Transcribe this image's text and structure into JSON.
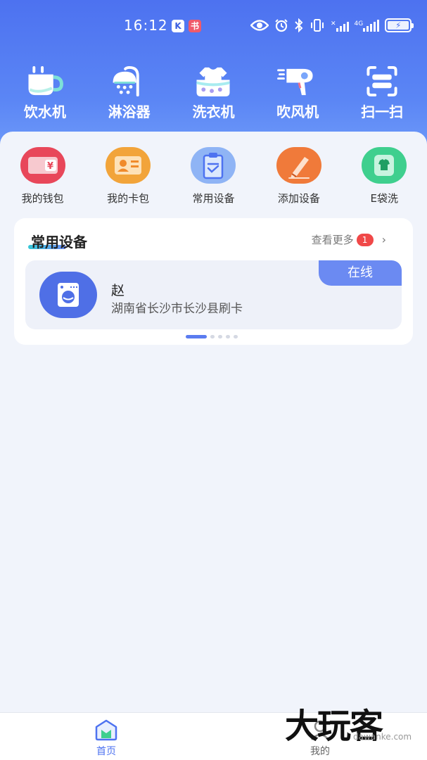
{
  "status_bar": {
    "time": "16:12",
    "app_icon_1": "K",
    "app_icon_2": "书",
    "network_label": "4G",
    "icons": [
      "eye-icon",
      "alarm-icon",
      "bluetooth-icon",
      "vibrate-icon",
      "x-icon",
      "signal-icon",
      "battery-icon"
    ]
  },
  "top_nav": {
    "items": [
      {
        "label": "饮水机",
        "icon": "water-dispenser-icon"
      },
      {
        "label": "淋浴器",
        "icon": "shower-icon"
      },
      {
        "label": "洗衣机",
        "icon": "washing-machine-icon"
      },
      {
        "label": "吹风机",
        "icon": "hair-dryer-icon"
      },
      {
        "label": "扫一扫",
        "icon": "scan-icon"
      }
    ]
  },
  "quick_actions": {
    "items": [
      {
        "label": "我的钱包",
        "icon": "wallet-icon",
        "color": "#e8475a"
      },
      {
        "label": "我的卡包",
        "icon": "card-holder-icon",
        "color": "#f2a43a"
      },
      {
        "label": "常用设备",
        "icon": "clipboard-icon",
        "color": "#8fb4f5"
      },
      {
        "label": "添加设备",
        "icon": "pen-icon",
        "color": "#f07a3a"
      },
      {
        "label": "E袋洗",
        "icon": "shirt-icon",
        "color": "#3fcf8e"
      }
    ]
  },
  "common_devices": {
    "title": "常用设备",
    "see_more_label": "查看更多",
    "badge_count": "1",
    "arrow": "›",
    "device": {
      "name": "赵",
      "location": "湖南省长沙市长沙县刷卡",
      "status": "在线"
    }
  },
  "tab_bar": {
    "home_label": "首页",
    "mine_label": "我的"
  },
  "watermark": {
    "text": "大玩客",
    "sub": "dawanke.com"
  },
  "colors": {
    "header_top": "#4d72f0",
    "header_bottom": "#7aa6fb",
    "accent": "#5b7cf0",
    "badge": "#f04848"
  }
}
